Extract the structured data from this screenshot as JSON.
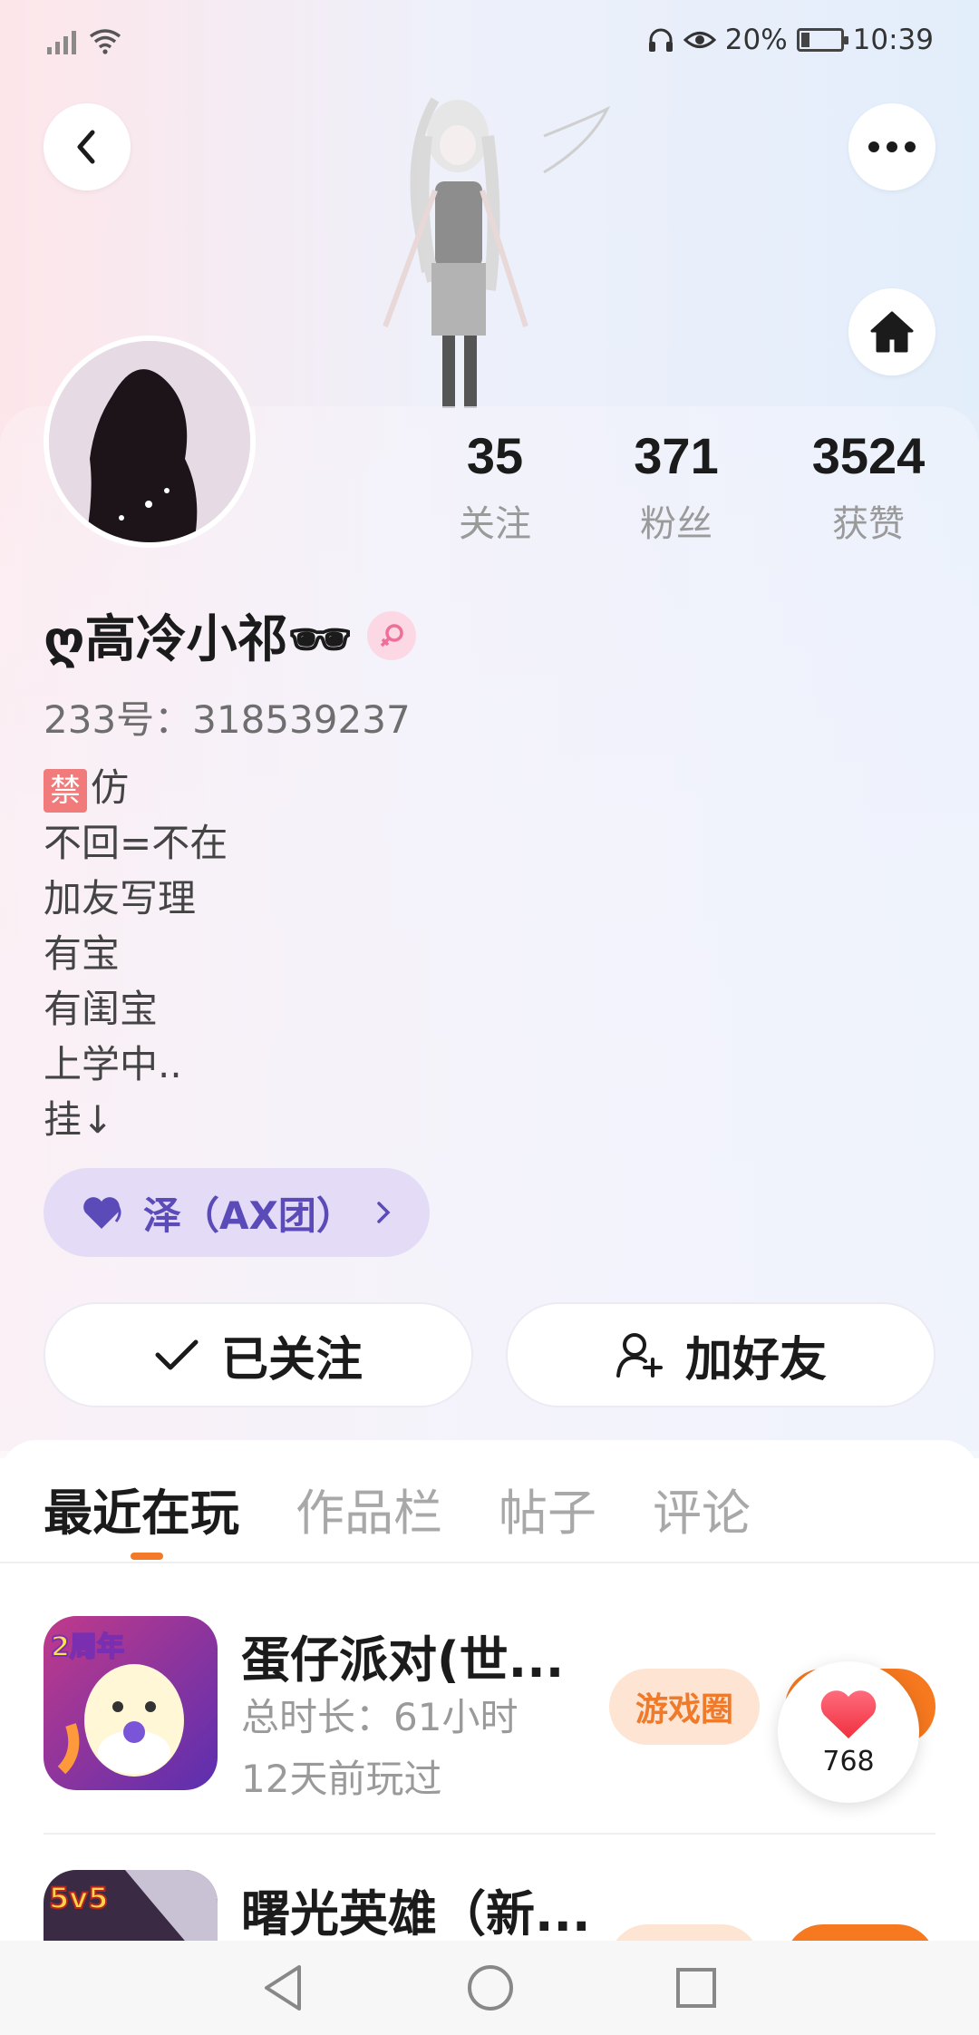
{
  "status_bar": {
    "battery_percent": "20%",
    "time": "10:39"
  },
  "profile": {
    "stats": [
      {
        "value": "35",
        "label": "关注"
      },
      {
        "value": "371",
        "label": "粉丝"
      },
      {
        "value": "3524",
        "label": "获赞"
      }
    ],
    "nickname": "ღ高冷小祁🕶",
    "uid": "233号：318539237",
    "bio_first_mark": "禁",
    "bio_lines": [
      "仿",
      "不回=不在",
      "加友写理",
      "有宝",
      "有闺宝",
      "上学中..",
      "挂↓"
    ],
    "group_name": "泽（AX团）",
    "follow_button": "已关注",
    "add_friend_button": "加好友"
  },
  "tabs": [
    "最近在玩",
    "作品栏",
    "帖子",
    "评论"
  ],
  "games": [
    {
      "title": "蛋仔派对(世...",
      "duration": "总时长：61小时",
      "last_played": "12天前玩过",
      "circle_label": "游戏圈",
      "icon_badge": "2周年"
    },
    {
      "title": "曙光英雄（新...",
      "icon_badge": "5v5"
    }
  ],
  "like_float": {
    "count": "768"
  },
  "colors": {
    "accent_orange": "#f6781f",
    "chip_purple": "#5a4bb8",
    "heart_red": "#f0445a"
  }
}
